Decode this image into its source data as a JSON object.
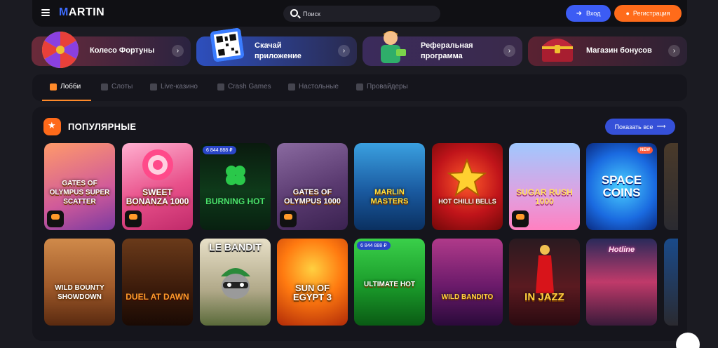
{
  "header": {
    "logo_letter": "M",
    "logo_rest": "ARTIN",
    "search_placeholder": "Поиск",
    "login_label": "Вход",
    "register_label": "Регистрация"
  },
  "promos": [
    {
      "label": "Колесо Фортуны"
    },
    {
      "label": "Скачай приложение"
    },
    {
      "label": "Реферальная программа"
    },
    {
      "label": "Магазин бонусов"
    }
  ],
  "categories": [
    {
      "label": "Лобби",
      "active": true
    },
    {
      "label": "Слоты"
    },
    {
      "label": "Live-казино"
    },
    {
      "label": "Crash Games"
    },
    {
      "label": "Настольные"
    },
    {
      "label": "Провайдеры"
    }
  ],
  "section": {
    "title": "ПОПУЛЯРНЫЕ",
    "show_all": "Показать все"
  },
  "games_row1": [
    {
      "name": "Gates of Olympus Super Scatter",
      "badge": "",
      "drops": true
    },
    {
      "name": "Sweet Bonanza 1000",
      "badge": "",
      "drops": true
    },
    {
      "name": "Burning Hot",
      "badge": "6 844 888 ₽",
      "drops": false
    },
    {
      "name": "Gates of Olympus 1000",
      "badge": "",
      "drops": true
    },
    {
      "name": "Marlin Masters",
      "badge": "",
      "drops": false
    },
    {
      "name": "Hot Chilli Bells",
      "badge": "",
      "drops": false
    },
    {
      "name": "Sugar Rush 1000",
      "badge": "",
      "drops": true
    },
    {
      "name": "Space Coins",
      "badge": "",
      "drops": false,
      "new": "NEW"
    }
  ],
  "games_row2": [
    {
      "name": "Wild Bounty Showdown",
      "badge": ""
    },
    {
      "name": "Duel at Dawn",
      "badge": ""
    },
    {
      "name": "Le Bandit",
      "badge": ""
    },
    {
      "name": "Sun of Egypt 3",
      "badge": ""
    },
    {
      "name": "Ultimate Hot",
      "badge": "6 844 888 ₽"
    },
    {
      "name": "Wild Bandito",
      "badge": ""
    },
    {
      "name": "In Jazz",
      "badge": ""
    },
    {
      "name": "Hotline",
      "badge": ""
    }
  ],
  "colors": {
    "accent_blue": "#3c5cf4",
    "accent_orange": "#ff6b1a",
    "background": "#1b1b22"
  }
}
